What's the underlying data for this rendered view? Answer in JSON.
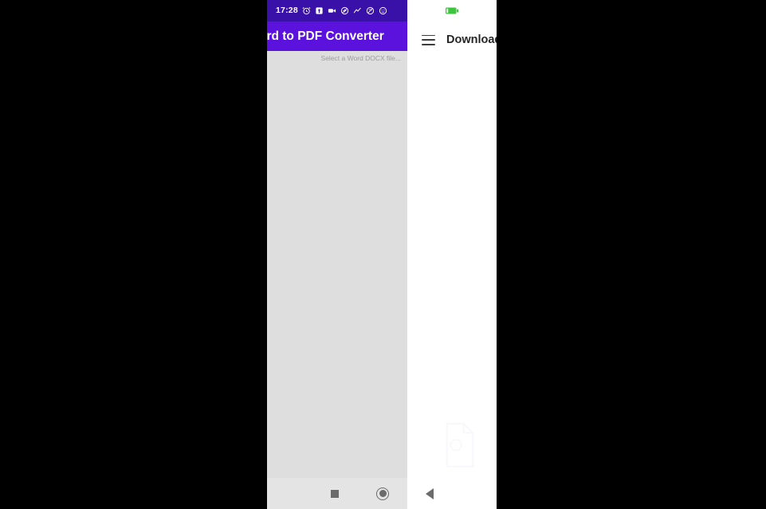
{
  "device": {
    "status_bar": {
      "clock": "17:28",
      "icons": [
        "alarm-clock-icon",
        "screenshot-icon",
        "video-camera-icon",
        "location-off-icon",
        "activity-icon",
        "sync-off-icon",
        "emoji-icon"
      ],
      "battery": {
        "icon": "battery-icon",
        "color": "#3ec43e"
      }
    },
    "app": {
      "title": "ord to PDF Converter",
      "full_title": "Word to PDF Converter",
      "subtitle": "Select a Word DOCX file...",
      "appbar_color": "#5a12dc",
      "statusbar_color": "#3a11a8",
      "background_color": "#dedede"
    },
    "right_panel": {
      "menu_icon": "hamburger-menu-icon",
      "title": "Download",
      "background_color": "#ffffff"
    },
    "nav_bar": {
      "recents_label": "recents-square-icon",
      "home_label": "home-circle-icon",
      "back_label": "back-triangle-icon",
      "background_color": "#e4e4e4"
    }
  }
}
